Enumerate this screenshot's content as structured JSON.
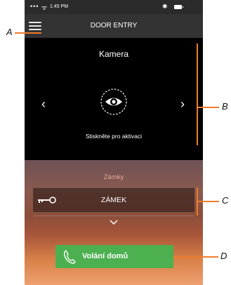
{
  "status_bar": {
    "dots": "•••",
    "wifi": "ᯤ",
    "time": "1:45 PM",
    "bluetooth": "✱"
  },
  "header": {
    "title": "DOOR ENTRY"
  },
  "camera": {
    "title": "Kamera",
    "activate_text": "Stiskněte pro aktivaci",
    "prev": "‹",
    "next": "›"
  },
  "locks": {
    "title": "Zámky",
    "items": [
      {
        "label": "ZÁMEK"
      }
    ]
  },
  "call": {
    "label": "Volání domů"
  },
  "callouts": {
    "a": "A",
    "b": "B",
    "c": "C",
    "d": "D"
  },
  "colors": {
    "accent": "#ef7d2e",
    "call_button": "#4caf50",
    "header": "#333333"
  }
}
